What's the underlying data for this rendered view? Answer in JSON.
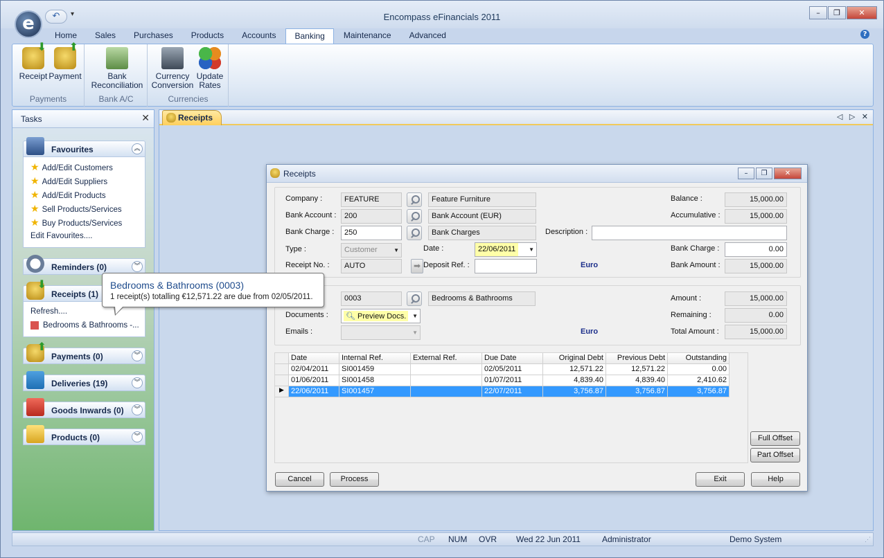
{
  "app": {
    "title": "Encompass eFinancials 2011"
  },
  "menu_tabs": [
    "Home",
    "Sales",
    "Purchases",
    "Products",
    "Accounts",
    "Banking",
    "Maintenance",
    "Advanced"
  ],
  "ribbon": {
    "receipt_label": "Receipt",
    "payment_label": "Payment",
    "payments_group": "Payments",
    "bank_rec_line1": "Bank",
    "bank_rec_line2": "Reconciliation",
    "bank_group": "Bank A/C",
    "currency_line1": "Currency",
    "currency_line2": "Conversion",
    "update_line1": "Update",
    "update_line2": "Rates",
    "currencies_group": "Currencies"
  },
  "tasks": {
    "title": "Tasks",
    "favourites": {
      "title": "Favourites",
      "items": [
        "Add/Edit Customers",
        "Add/Edit Suppliers",
        "Add/Edit Products",
        "Sell Products/Services",
        "Buy Products/Services"
      ],
      "edit": "Edit Favourites...."
    },
    "reminders": "Reminders (0)",
    "receipts": {
      "title": "Receipts (1)",
      "refresh": "Refresh....",
      "item": "Bedrooms & Bathrooms -..."
    },
    "payments": "Payments (0)",
    "deliveries": "Deliveries (19)",
    "goods_inwards": "Goods Inwards (0)",
    "products": "Products (0)"
  },
  "tooltip": {
    "title": "Bedrooms & Bathrooms (0003)",
    "text": "1 receipt(s) totalling €12,571.22 are due from 02/05/2011."
  },
  "doc_tab": "Receipts",
  "dialog": {
    "title": "Receipts",
    "company_label": "Company :",
    "company_code": "FEATURE",
    "company_name": "Feature Furniture",
    "bank_account_label": "Bank Account :",
    "bank_account_code": "200",
    "bank_account_name": "Bank Account (EUR)",
    "bank_charge_label": "Bank Charge :",
    "bank_charge_code": "250",
    "bank_charge_name": "Bank Charges",
    "description_label": "Description :",
    "description_value": "",
    "type_label": "Type :",
    "type_value": "Customer",
    "date_label": "Date :",
    "date_value": "22/06/2011",
    "receipt_no_label": "Receipt No. :",
    "receipt_no_value": "AUTO",
    "deposit_ref_label": "Deposit Ref. :",
    "deposit_ref_value": "",
    "currency_1": "Euro",
    "balance_label": "Balance :",
    "balance_value": "15,000.00",
    "accumulative_label": "Accumulative :",
    "accumulative_value": "15,000.00",
    "bank_charge_amt_label": "Bank Charge :",
    "bank_charge_amt_value": "0.00",
    "bank_amount_label": "Bank Amount :",
    "bank_amount_value": "15,000.00",
    "customer_code": "0003",
    "customer_name": "Bedrooms & Bathrooms",
    "documents_label": "Documents :",
    "documents_value": "Preview Docs.",
    "emails_label": "Emails :",
    "emails_value": "",
    "currency_2": "Euro",
    "amount_label": "Amount :",
    "amount_value": "15,000.00",
    "remaining_label": "Remaining :",
    "remaining_value": "0.00",
    "total_amount_label": "Total Amount :",
    "total_amount_value": "15,000.00",
    "grid": {
      "columns": [
        "Date",
        "Internal Ref.",
        "External Ref.",
        "Due Date",
        "Original Debt",
        "Previous Debt",
        "Outstanding"
      ],
      "rows": [
        [
          "02/04/2011",
          "SI001459",
          "",
          "02/05/2011",
          "12,571.22",
          "12,571.22",
          "0.00"
        ],
        [
          "01/06/2011",
          "SI001458",
          "",
          "01/07/2011",
          "4,839.40",
          "4,839.40",
          "2,410.62"
        ],
        [
          "22/06/2011",
          "SI001457",
          "",
          "22/07/2011",
          "3,756.87",
          "3,756.87",
          "3,756.87"
        ]
      ]
    },
    "full_offset": "Full Offset",
    "part_offset": "Part Offset",
    "cancel": "Cancel",
    "process": "Process",
    "exit": "Exit",
    "help": "Help"
  },
  "status": {
    "cap": "CAP",
    "num": "NUM",
    "ovr": "OVR",
    "date": "Wed 22 Jun 2011",
    "user": "Administrator",
    "system": "Demo System"
  }
}
